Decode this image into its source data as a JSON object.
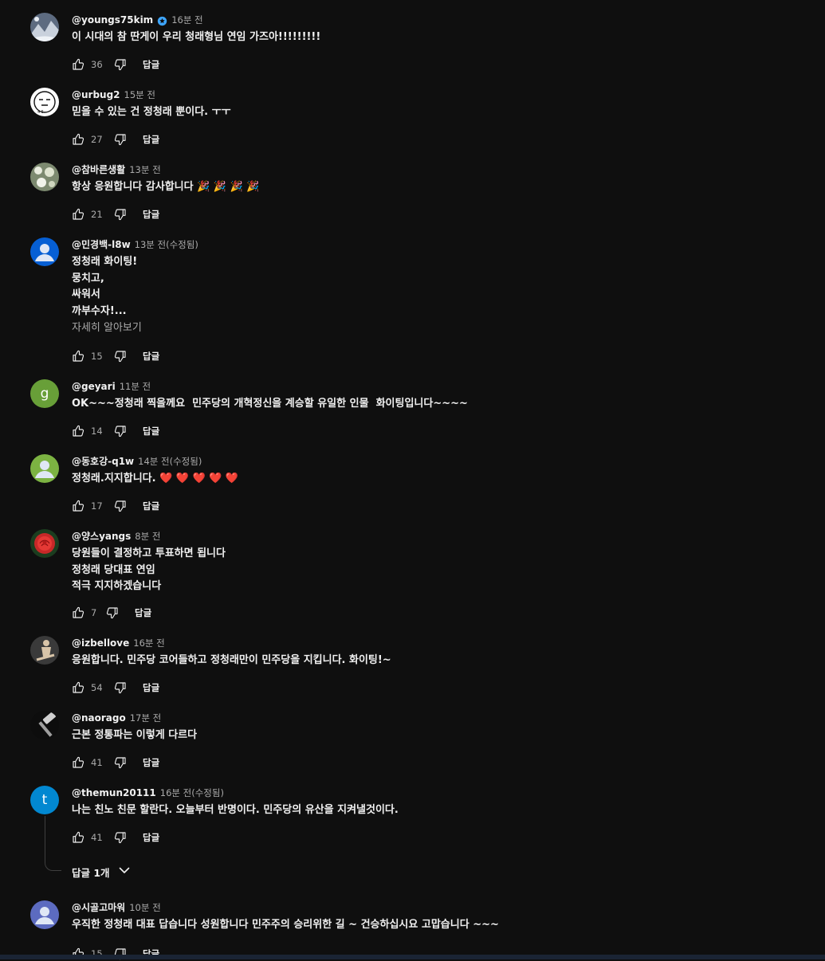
{
  "comments": [
    {
      "author": "@youngs75kim",
      "verified": true,
      "time": "16분 전",
      "text": "이 시대의 참 딴게이 우리 청래형님 연임 가즈아!!!!!!!!!",
      "likes": "36",
      "avatar": {
        "kind": "photo-snow",
        "color": "#8a93a6"
      }
    },
    {
      "author": "@urbug2",
      "time": "15분 전",
      "text": "믿을 수 있는 건 정청래 뿐이다. ㅜㅜ",
      "likes": "27",
      "avatar": {
        "kind": "drawing-face",
        "color": "#ffffff"
      }
    },
    {
      "author": "@참바른생활",
      "time": "13분 전",
      "text": "항상 응원합니다 감사합니다 🎉 🎉 🎉 🎉",
      "likes": "21",
      "avatar": {
        "kind": "photo-flowers",
        "color": "#a9b09a"
      }
    },
    {
      "author": "@민경백-l8w",
      "time": "13분 전(수정됨)",
      "text": "정청래 화이팅!\n뭉치고,\n싸워서\n까부수자!...",
      "read_more": "자세히 알아보기",
      "likes": "15",
      "avatar": {
        "kind": "default-person",
        "color": "#065fd4"
      }
    },
    {
      "author": "@geyari",
      "time": "11분 전",
      "text": "OK~~~정청래 찍을께요  민주당의 개혁정신을 계승할 유일한 인물  화이팅입니다~~~~",
      "likes": "14",
      "avatar": {
        "kind": "letter",
        "letter": "g",
        "color": "#689f38"
      }
    },
    {
      "author": "@동호강-q1w",
      "time": "14분 전(수정됨)",
      "text": "정청래.지지합니다. ❤️ ❤️ ❤️ ❤️ ❤️",
      "likes": "17",
      "avatar": {
        "kind": "default-person",
        "color": "#7cb342"
      }
    },
    {
      "author": "@양스yangs",
      "time": "8분 전",
      "text": "당원들이 결정하고 투표하면 됩니다\n정청래 당대표 연임\n적극 지지하겠습니다",
      "likes": "7",
      "avatar": {
        "kind": "photo-rose",
        "color": "#c62828"
      }
    },
    {
      "author": "@izbellove",
      "time": "16분 전",
      "text": "응원합니다. 민주당 코어들하고 정청래만이 민주당을 지킵니다. 화이팅!~",
      "likes": "54",
      "avatar": {
        "kind": "photo-figure",
        "color": "#2a2a2a"
      }
    },
    {
      "author": "@naorago",
      "time": "17분 전",
      "text": "근본 정통파는 이렇게 다르다",
      "likes": "41",
      "avatar": {
        "kind": "photo-hammer",
        "color": "#0f0f0f"
      }
    },
    {
      "author": "@themun20111",
      "time": "16분 전(수정됨)",
      "text": "나는 친노 친문 할란다. 오늘부터 반명이다. 민주당의 유산을 지켜낼것이다.",
      "likes": "41",
      "avatar": {
        "kind": "letter",
        "letter": "t",
        "color": "#0288d1"
      }
    },
    {
      "author": "@시골고마워",
      "time": "10분 전",
      "text": "우직한 정청래 대표 답습니다 성원합니다 민주주의 승리위한 길 ~ 건승하십시요 고맙습니다 ~~~",
      "likes": "15",
      "avatar": {
        "kind": "default-person",
        "color": "#5c6bc0"
      }
    }
  ],
  "labels": {
    "reply": "답글",
    "replies_toggle": "답글 1개"
  },
  "icons": {
    "like": "thumbs-up-icon",
    "dislike": "thumbs-down-icon",
    "verified": "verified-badge-icon",
    "expand": "chevron-down-icon"
  },
  "colors": {
    "background": "#0f0f0f",
    "text_primary": "#f1f1f1",
    "text_secondary": "#aaaaaa",
    "verified_badge": "#3ea6ff"
  }
}
